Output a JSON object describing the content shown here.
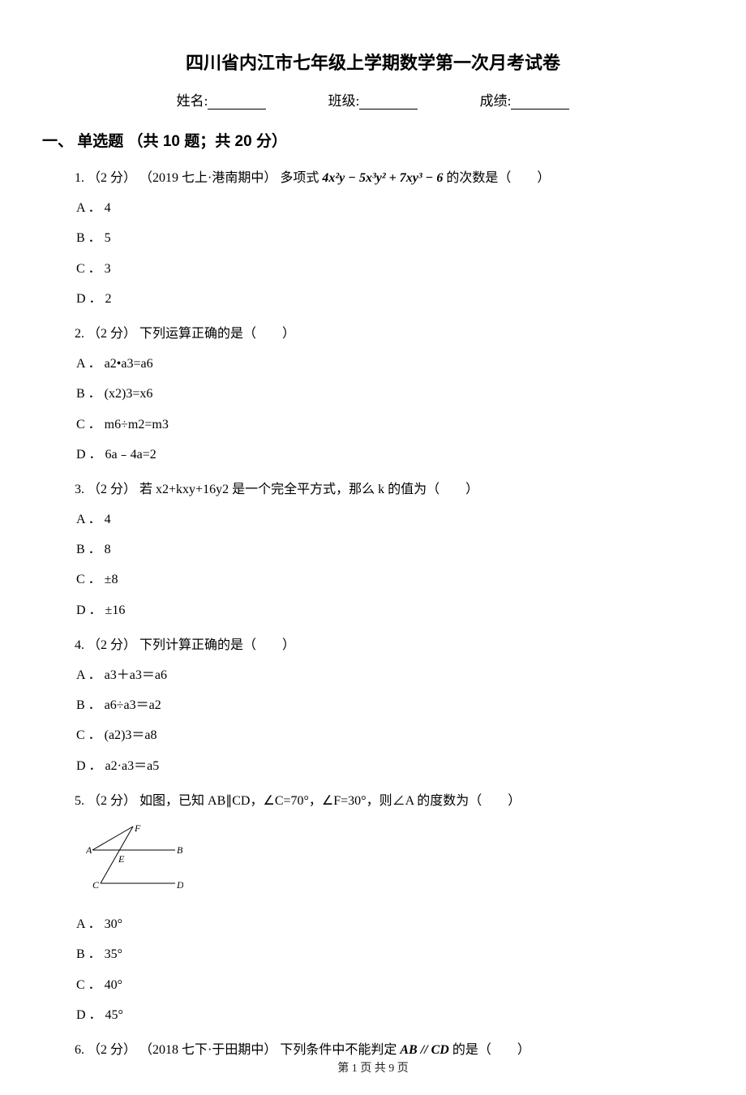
{
  "title": "四川省内江市七年级上学期数学第一次月考试卷",
  "info": {
    "name_label": "姓名:",
    "class_label": "班级:",
    "score_label": "成绩:"
  },
  "section": {
    "heading": "一、 单选题 （共 10 题；共 20 分）"
  },
  "questions": [
    {
      "num": "1.",
      "points": "（2 分）",
      "source": "（2019 七上·港南期中）",
      "stem_a": "多项式 ",
      "formula": "4x²y − 5x³y² + 7xy³ − 6",
      "stem_b": " 的次数是（　　）",
      "options": [
        "A ． 4",
        "B ． 5",
        "C ． 3",
        "D ． 2"
      ]
    },
    {
      "num": "2.",
      "points": "（2 分）",
      "stem": " 下列运算正确的是（　　）",
      "options": [
        "A ． a2•a3=a6",
        "B ． (x2)3=x6",
        "C ． m6÷m2=m3",
        "D ． 6a﹣4a=2"
      ]
    },
    {
      "num": "3.",
      "points": "（2 分）",
      "stem": " 若 x2+kxy+16y2 是一个完全平方式，那么 k 的值为（　　）",
      "options": [
        "A ． 4",
        "B ． 8",
        "C ． ±8",
        "D ． ±16"
      ]
    },
    {
      "num": "4.",
      "points": "（2 分）",
      "stem": " 下列计算正确的是（　　）",
      "options": [
        "A ． a3＋a3＝a6",
        "B ． a6÷a3＝a2",
        "C ． (a2)3＝a8",
        "D ． a2·a3＝a5"
      ]
    },
    {
      "num": "5.",
      "points": "（2 分）",
      "stem": " 如图，已知 AB∥CD，∠C=70°，∠F=30°，则∠A 的度数为（　　）",
      "options": [
        "A ． 30°",
        "B ． 35°",
        "C ． 40°",
        "D ． 45°"
      ],
      "has_diagram": true
    },
    {
      "num": "6.",
      "points": "（2 分）",
      "source": "（2018 七下·于田期中）",
      "stem_a": "下列条件中不能判定 ",
      "formula_b": "AB // CD",
      "stem_b": " 的是（　　）"
    }
  ],
  "footer": "第 1 页 共 9 页"
}
